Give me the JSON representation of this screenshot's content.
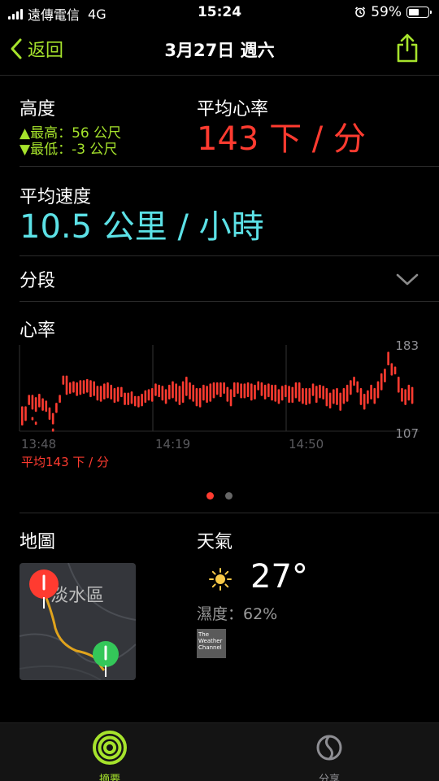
{
  "status_bar": {
    "carrier": "遠傳電信",
    "network": "4G",
    "time": "15:24",
    "battery": "59%",
    "battery_level": 0.59
  },
  "nav": {
    "back_label": "返回",
    "title": "3月27日 週六"
  },
  "elevation": {
    "label": "高度",
    "high": "▲最高：56 公尺",
    "low": "▼最低：-3 公尺"
  },
  "avg_hr": {
    "label": "平均心率",
    "value": "143 下 / 分"
  },
  "avg_speed": {
    "label": "平均速度",
    "value": "10.5 公里 / 小時"
  },
  "segments": {
    "label": "分段"
  },
  "heart_rate": {
    "label": "心率",
    "avg_label": "平均143 下 / 分"
  },
  "chart_data": {
    "type": "bar",
    "title": "心率",
    "x_tick_labels": [
      "13:48",
      "14:19",
      "14:50"
    ],
    "y_tick_labels": [
      "183",
      "107"
    ],
    "ylim": [
      107,
      183
    ],
    "note_series_color": "#ff3b30",
    "series": [
      {
        "name": "心率",
        "min": [
          112,
          116,
          130,
          126,
          124,
          128,
          125,
          124,
          117,
          113,
          123,
          132,
          148,
          139,
          140,
          141,
          138,
          139,
          140,
          141,
          137,
          138,
          134,
          133,
          135,
          136,
          135,
          132,
          133,
          137,
          130,
          130,
          131,
          129,
          128,
          129,
          132,
          134,
          133,
          138,
          137,
          134,
          131,
          135,
          136,
          133,
          130,
          132,
          138,
          135,
          133,
          129,
          128,
          134,
          132,
          133,
          136,
          139,
          137,
          140,
          133,
          129,
          137,
          140,
          136,
          136,
          137,
          134,
          135,
          143,
          138,
          135,
          137,
          134,
          133,
          131,
          134,
          137,
          132,
          132,
          136,
          133,
          131,
          130,
          131,
          138,
          132,
          136,
          135,
          129,
          127,
          131,
          130,
          125,
          131,
          133,
          139,
          147,
          141,
          130,
          126,
          131,
          135,
          131,
          136,
          143,
          150,
          165,
          156,
          157,
          141,
          133,
          130,
          134,
          131
        ],
        "max": [
          129,
          129,
          139,
          139,
          137,
          140,
          136,
          134,
          128,
          123,
          132,
          139,
          156,
          156,
          150,
          151,
          150,
          152,
          152,
          153,
          152,
          151,
          147,
          147,
          149,
          150,
          148,
          145,
          146,
          146,
          141,
          141,
          142,
          138,
          138,
          140,
          143,
          144,
          145,
          149,
          148,
          147,
          144,
          148,
          151,
          149,
          147,
          151,
          155,
          150,
          148,
          145,
          145,
          148,
          147,
          149,
          150,
          150,
          150,
          150,
          146,
          144,
          150,
          150,
          149,
          149,
          150,
          149,
          148,
          151,
          150,
          148,
          149,
          148,
          148,
          144,
          147,
          148,
          147,
          146,
          150,
          150,
          145,
          145,
          145,
          149,
          147,
          148,
          147,
          145,
          141,
          144,
          145,
          141,
          145,
          148,
          152,
          155,
          151,
          145,
          140,
          143,
          148,
          145,
          151,
          158,
          162,
          177,
          167,
          164,
          155,
          145,
          144,
          148,
          146
        ]
      }
    ],
    "outlier_points": [
      {
        "x_index": 3,
        "value": 118
      },
      {
        "x_index": 4,
        "value": 114
      },
      {
        "x_index": 9,
        "value": 108
      }
    ]
  },
  "pagination": {
    "count": 2,
    "active": 0
  },
  "map": {
    "label": "地圖",
    "place": "淡水區",
    "marker_start_color": "#ff3b30",
    "marker_end_color": "#34c759"
  },
  "weather": {
    "label": "天氣",
    "icon": "sun-icon",
    "temperature": "27°",
    "humidity": "濕度：62%",
    "provider_logo": "The Weather Channel"
  },
  "tabbar": {
    "summary_label": "摘要",
    "share_label": "分享",
    "active_color": "#a6e32c"
  }
}
